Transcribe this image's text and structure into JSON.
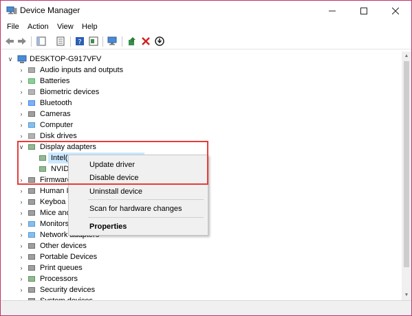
{
  "window": {
    "title": "Device Manager"
  },
  "menu": [
    "File",
    "Action",
    "View",
    "Help"
  ],
  "toolbar": [
    "back-icon",
    "forward-icon",
    "properties-icon",
    "update-icon",
    "help-icon",
    "view-icon",
    "scan-icon",
    "add-driver-icon",
    "uninstall-icon",
    "download-icon"
  ],
  "tree": {
    "root": "DESKTOP-G917VFV",
    "items": [
      {
        "label": "Audio inputs and outputs",
        "icon": "speaker-icon",
        "color": "#6b6b6b"
      },
      {
        "label": "Batteries",
        "icon": "battery-icon",
        "color": "#3aa34a"
      },
      {
        "label": "Biometric devices",
        "icon": "fingerprint-icon",
        "color": "#7a7a7a"
      },
      {
        "label": "Bluetooth",
        "icon": "bluetooth-icon",
        "color": "#1a73e8"
      },
      {
        "label": "Cameras",
        "icon": "camera-icon",
        "color": "#555"
      },
      {
        "label": "Computer",
        "icon": "computer-icon",
        "color": "#2d8ad6"
      },
      {
        "label": "Disk drives",
        "icon": "disk-icon",
        "color": "#777"
      },
      {
        "label": "Display adapters",
        "icon": "display-adapter-icon",
        "color": "#3f7f3f",
        "expanded": true
      },
      {
        "label": "Intel(R) UHD Graphics 620",
        "visible": "Intel(R) UHD Graphics 620",
        "icon": "display-adapter-icon",
        "child": true,
        "selected": true
      },
      {
        "label": "NVIDIA",
        "icon": "display-adapter-icon",
        "child": true
      },
      {
        "label": "Firmware",
        "icon": "firmware-icon",
        "color": "#555"
      },
      {
        "label": "Human Interface Devices",
        "visible": "Human In",
        "icon": "hid-icon",
        "color": "#555"
      },
      {
        "label": "Keyboards",
        "visible": "Keyboa",
        "icon": "keyboard-icon",
        "color": "#555"
      },
      {
        "label": "Mice and other pointing devices",
        "visible": "Mice anc",
        "icon": "mouse-icon",
        "color": "#555"
      },
      {
        "label": "Monitors",
        "visible": "Monitors",
        "icon": "monitor-icon",
        "color": "#2d8ad6"
      },
      {
        "label": "Network adapters",
        "icon": "network-icon",
        "color": "#2d8ad6"
      },
      {
        "label": "Other devices",
        "icon": "other-devices-icon",
        "color": "#555"
      },
      {
        "label": "Portable Devices",
        "icon": "portable-devices-icon",
        "color": "#555"
      },
      {
        "label": "Print queues",
        "icon": "printer-icon",
        "color": "#555"
      },
      {
        "label": "Processors",
        "icon": "processor-icon",
        "color": "#3f7f3f"
      },
      {
        "label": "Security devices",
        "icon": "security-icon",
        "color": "#555"
      },
      {
        "label": "System devices",
        "icon": "system-icon",
        "color": "#555"
      }
    ]
  },
  "context_menu": {
    "items": [
      "Update driver",
      "Disable device",
      "Uninstall device",
      "Scan for hardware changes",
      "Properties"
    ]
  }
}
